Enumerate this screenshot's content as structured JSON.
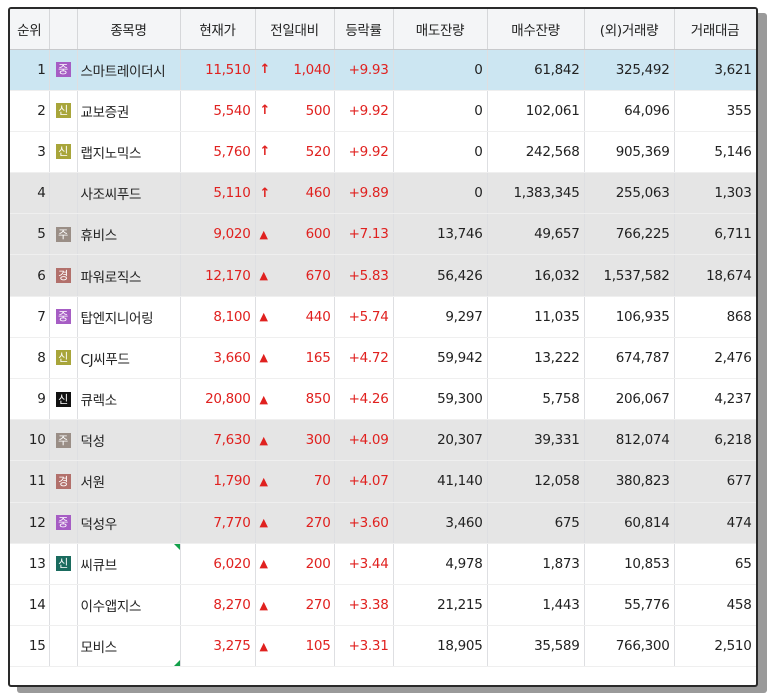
{
  "headers": {
    "rank": "순위",
    "name": "종목명",
    "price": "현재가",
    "change": "전일대비",
    "pct": "등락률",
    "ask": "매도잔량",
    "bid": "매수잔량",
    "volume": "(외)거래량",
    "amount": "거래대금"
  },
  "arrow_up": "↑",
  "arrow_tri": "▲",
  "rows": [
    {
      "rank": "1",
      "badge": "중",
      "badge_color": "#a65dc4",
      "name": "스마트레이더시",
      "price": "11,510",
      "arrow": "↑",
      "change": "1,040",
      "pct": "+9.93",
      "ask": "0",
      "bid": "61,842",
      "volume": "325,492",
      "amount": "3,621",
      "bg": "hl"
    },
    {
      "rank": "2",
      "badge": "신",
      "badge_color": "#a8a53a",
      "name": "교보증권",
      "price": "5,540",
      "arrow": "↑",
      "change": "500",
      "pct": "+9.92",
      "ask": "0",
      "bid": "102,061",
      "volume": "64,096",
      "amount": "355",
      "bg": "white"
    },
    {
      "rank": "3",
      "badge": "신",
      "badge_color": "#a8a53a",
      "name": "랩지노믹스",
      "price": "5,760",
      "arrow": "↑",
      "change": "520",
      "pct": "+9.92",
      "ask": "0",
      "bid": "242,568",
      "volume": "905,369",
      "amount": "5,146",
      "bg": "white"
    },
    {
      "rank": "4",
      "badge": "",
      "badge_color": "",
      "name": "사조씨푸드",
      "price": "5,110",
      "arrow": "↑",
      "change": "460",
      "pct": "+9.89",
      "ask": "0",
      "bid": "1,383,345",
      "volume": "255,063",
      "amount": "1,303",
      "bg": "gray"
    },
    {
      "rank": "5",
      "badge": "주",
      "badge_color": "#9a8e86",
      "name": "휴비스",
      "price": "9,020",
      "arrow": "▲",
      "change": "600",
      "pct": "+7.13",
      "ask": "13,746",
      "bid": "49,657",
      "volume": "766,225",
      "amount": "6,711",
      "bg": "gray"
    },
    {
      "rank": "6",
      "badge": "경",
      "badge_color": "#b2706b",
      "name": "파워로직스",
      "price": "12,170",
      "arrow": "▲",
      "change": "670",
      "pct": "+5.83",
      "ask": "56,426",
      "bid": "16,032",
      "volume": "1,537,582",
      "amount": "18,674",
      "bg": "gray"
    },
    {
      "rank": "7",
      "badge": "중",
      "badge_color": "#a65dc4",
      "name": "탑엔지니어링",
      "price": "8,100",
      "arrow": "▲",
      "change": "440",
      "pct": "+5.74",
      "ask": "9,297",
      "bid": "11,035",
      "volume": "106,935",
      "amount": "868",
      "bg": "white"
    },
    {
      "rank": "8",
      "badge": "신",
      "badge_color": "#a8a53a",
      "name": "CJ씨푸드",
      "price": "3,660",
      "arrow": "▲",
      "change": "165",
      "pct": "+4.72",
      "ask": "59,942",
      "bid": "13,222",
      "volume": "674,787",
      "amount": "2,476",
      "bg": "white"
    },
    {
      "rank": "9",
      "badge": "신",
      "badge_color": "#111111",
      "name": "큐렉소",
      "price": "20,800",
      "arrow": "▲",
      "change": "850",
      "pct": "+4.26",
      "ask": "59,300",
      "bid": "5,758",
      "volume": "206,067",
      "amount": "4,237",
      "bg": "white"
    },
    {
      "rank": "10",
      "badge": "주",
      "badge_color": "#9a8e86",
      "name": "덕성",
      "price": "7,630",
      "arrow": "▲",
      "change": "300",
      "pct": "+4.09",
      "ask": "20,307",
      "bid": "39,331",
      "volume": "812,074",
      "amount": "6,218",
      "bg": "gray"
    },
    {
      "rank": "11",
      "badge": "경",
      "badge_color": "#b2706b",
      "name": "서원",
      "price": "1,790",
      "arrow": "▲",
      "change": "70",
      "pct": "+4.07",
      "ask": "41,140",
      "bid": "12,058",
      "volume": "380,823",
      "amount": "677",
      "bg": "gray"
    },
    {
      "rank": "12",
      "badge": "중",
      "badge_color": "#a65dc4",
      "name": "덕성우",
      "price": "7,770",
      "arrow": "▲",
      "change": "270",
      "pct": "+3.60",
      "ask": "3,460",
      "bid": "675",
      "volume": "60,814",
      "amount": "474",
      "bg": "gray"
    },
    {
      "rank": "13",
      "badge": "신",
      "badge_color": "#1a6b5e",
      "name": "씨큐브",
      "price": "6,020",
      "arrow": "▲",
      "change": "200",
      "pct": "+3.44",
      "ask": "4,978",
      "bid": "1,873",
      "volume": "10,853",
      "amount": "65",
      "bg": "white",
      "mark": "top"
    },
    {
      "rank": "14",
      "badge": "",
      "badge_color": "",
      "name": "이수앱지스",
      "price": "8,270",
      "arrow": "▲",
      "change": "270",
      "pct": "+3.38",
      "ask": "21,215",
      "bid": "1,443",
      "volume": "55,776",
      "amount": "458",
      "bg": "white"
    },
    {
      "rank": "15",
      "badge": "",
      "badge_color": "",
      "name": "모비스",
      "price": "3,275",
      "arrow": "▲",
      "change": "105",
      "pct": "+3.31",
      "ask": "18,905",
      "bid": "35,589",
      "volume": "766,300",
      "amount": "2,510",
      "bg": "white",
      "mark": "bottom"
    }
  ]
}
